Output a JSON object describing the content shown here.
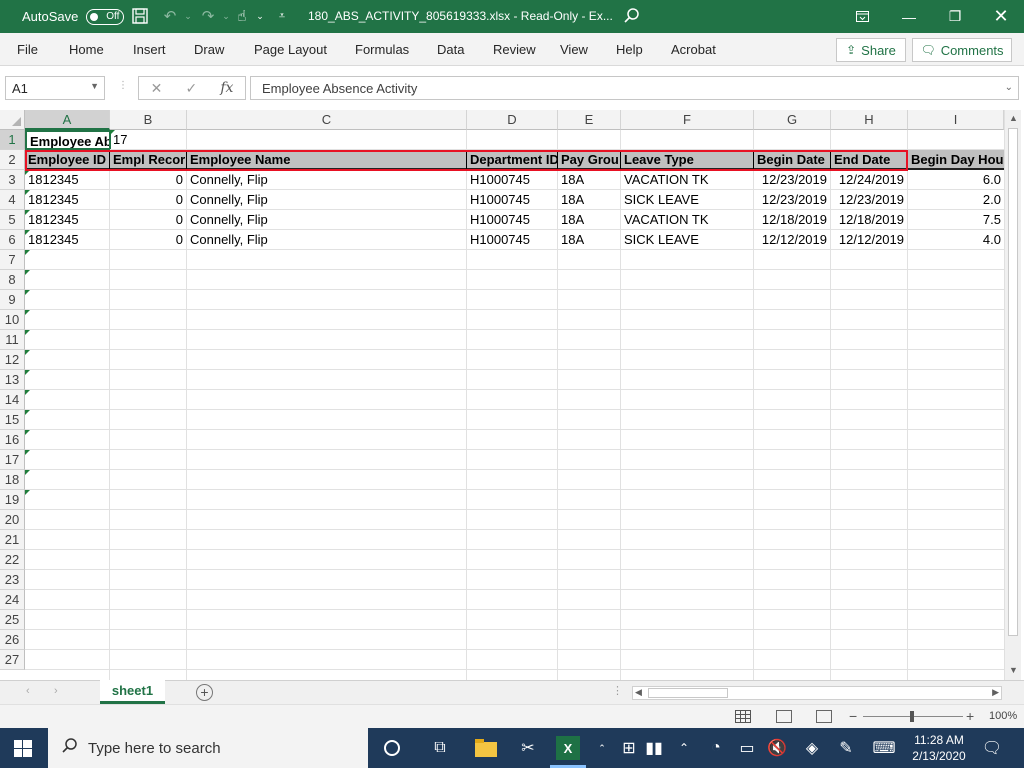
{
  "titlebar": {
    "autosave_label": "AutoSave",
    "autosave_state": "Off",
    "filename": "180_ABS_ACTIVITY_805619333.xlsx  -  Read-Only  -  Ex...",
    "accent": "#217346"
  },
  "ribbon": {
    "tabs": [
      "File",
      "Home",
      "Insert",
      "Draw",
      "Page Layout",
      "Formulas",
      "Data",
      "Review",
      "View",
      "Help",
      "Acrobat"
    ],
    "share_label": "Share",
    "comments_label": "Comments"
  },
  "formula_bar": {
    "name_box": "A1",
    "fx": "fx",
    "value": "Employee Absence Activity"
  },
  "columns": [
    "A",
    "B",
    "C",
    "D",
    "E",
    "F",
    "G",
    "H",
    "I"
  ],
  "rows": [
    "1",
    "2",
    "3",
    "4",
    "5",
    "6",
    "7",
    "8",
    "9",
    "10",
    "11",
    "12",
    "13",
    "14",
    "15",
    "16",
    "17",
    "18",
    "19",
    "20",
    "21",
    "22",
    "23",
    "24",
    "25",
    "26",
    "27"
  ],
  "sheet": {
    "row1": {
      "a": "Employee Ab",
      "b": "17"
    },
    "headers": [
      "Employee ID",
      "Empl Recor",
      "Employee Name",
      "Department ID",
      "Pay Grou",
      "Leave Type",
      "Begin Date",
      "End Date",
      "Begin Day Hou"
    ],
    "data": [
      [
        "1812345",
        "0",
        "Connelly, Flip",
        "H1000745",
        "18A",
        "VACATION TK",
        "12/23/2019",
        "12/24/2019",
        "6.0"
      ],
      [
        "1812345",
        "0",
        "Connelly, Flip",
        "H1000745",
        "18A",
        "SICK LEAVE",
        "12/23/2019",
        "12/23/2019",
        "2.0"
      ],
      [
        "1812345",
        "0",
        "Connelly, Flip",
        "H1000745",
        "18A",
        "VACATION TK",
        "12/18/2019",
        "12/18/2019",
        "7.5"
      ],
      [
        "1812345",
        "0",
        "Connelly, Flip",
        "H1000745",
        "18A",
        "SICK LEAVE",
        "12/12/2019",
        "12/12/2019",
        "4.0"
      ]
    ]
  },
  "sheet_tabs": {
    "active": "sheet1"
  },
  "statusbar": {
    "zoom": "100%"
  },
  "taskbar": {
    "search_placeholder": "Type here to search",
    "time": "11:28 AM",
    "date": "2/13/2020"
  }
}
